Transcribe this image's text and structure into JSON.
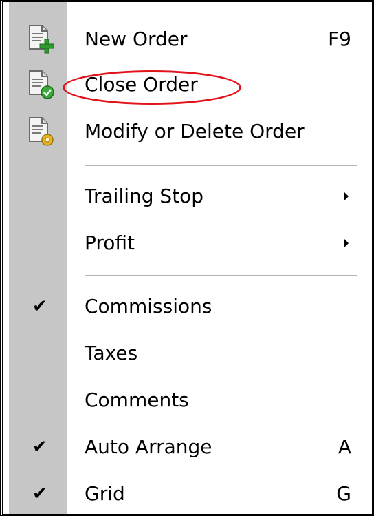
{
  "menu": {
    "items": [
      {
        "label": "New Order",
        "shortcut": "F9",
        "icon": "new-order-icon"
      },
      {
        "label": "Close Order",
        "shortcut": "",
        "icon": "close-order-icon"
      },
      {
        "label": "Modify or Delete Order",
        "shortcut": "",
        "icon": "modify-order-icon"
      },
      {
        "label": "Trailing Stop",
        "submenu": true
      },
      {
        "label": "Profit",
        "submenu": true
      },
      {
        "label": "Commissions",
        "checked": true
      },
      {
        "label": "Taxes",
        "checked": false
      },
      {
        "label": "Comments",
        "checked": false
      },
      {
        "label": "Auto Arrange",
        "shortcut": "A",
        "checked": true
      },
      {
        "label": "Grid",
        "shortcut": "G",
        "checked": true
      }
    ],
    "check_glyph": "✔"
  },
  "colors": {
    "gutter": "#c6c6c6",
    "highlight": "#e0141a"
  }
}
